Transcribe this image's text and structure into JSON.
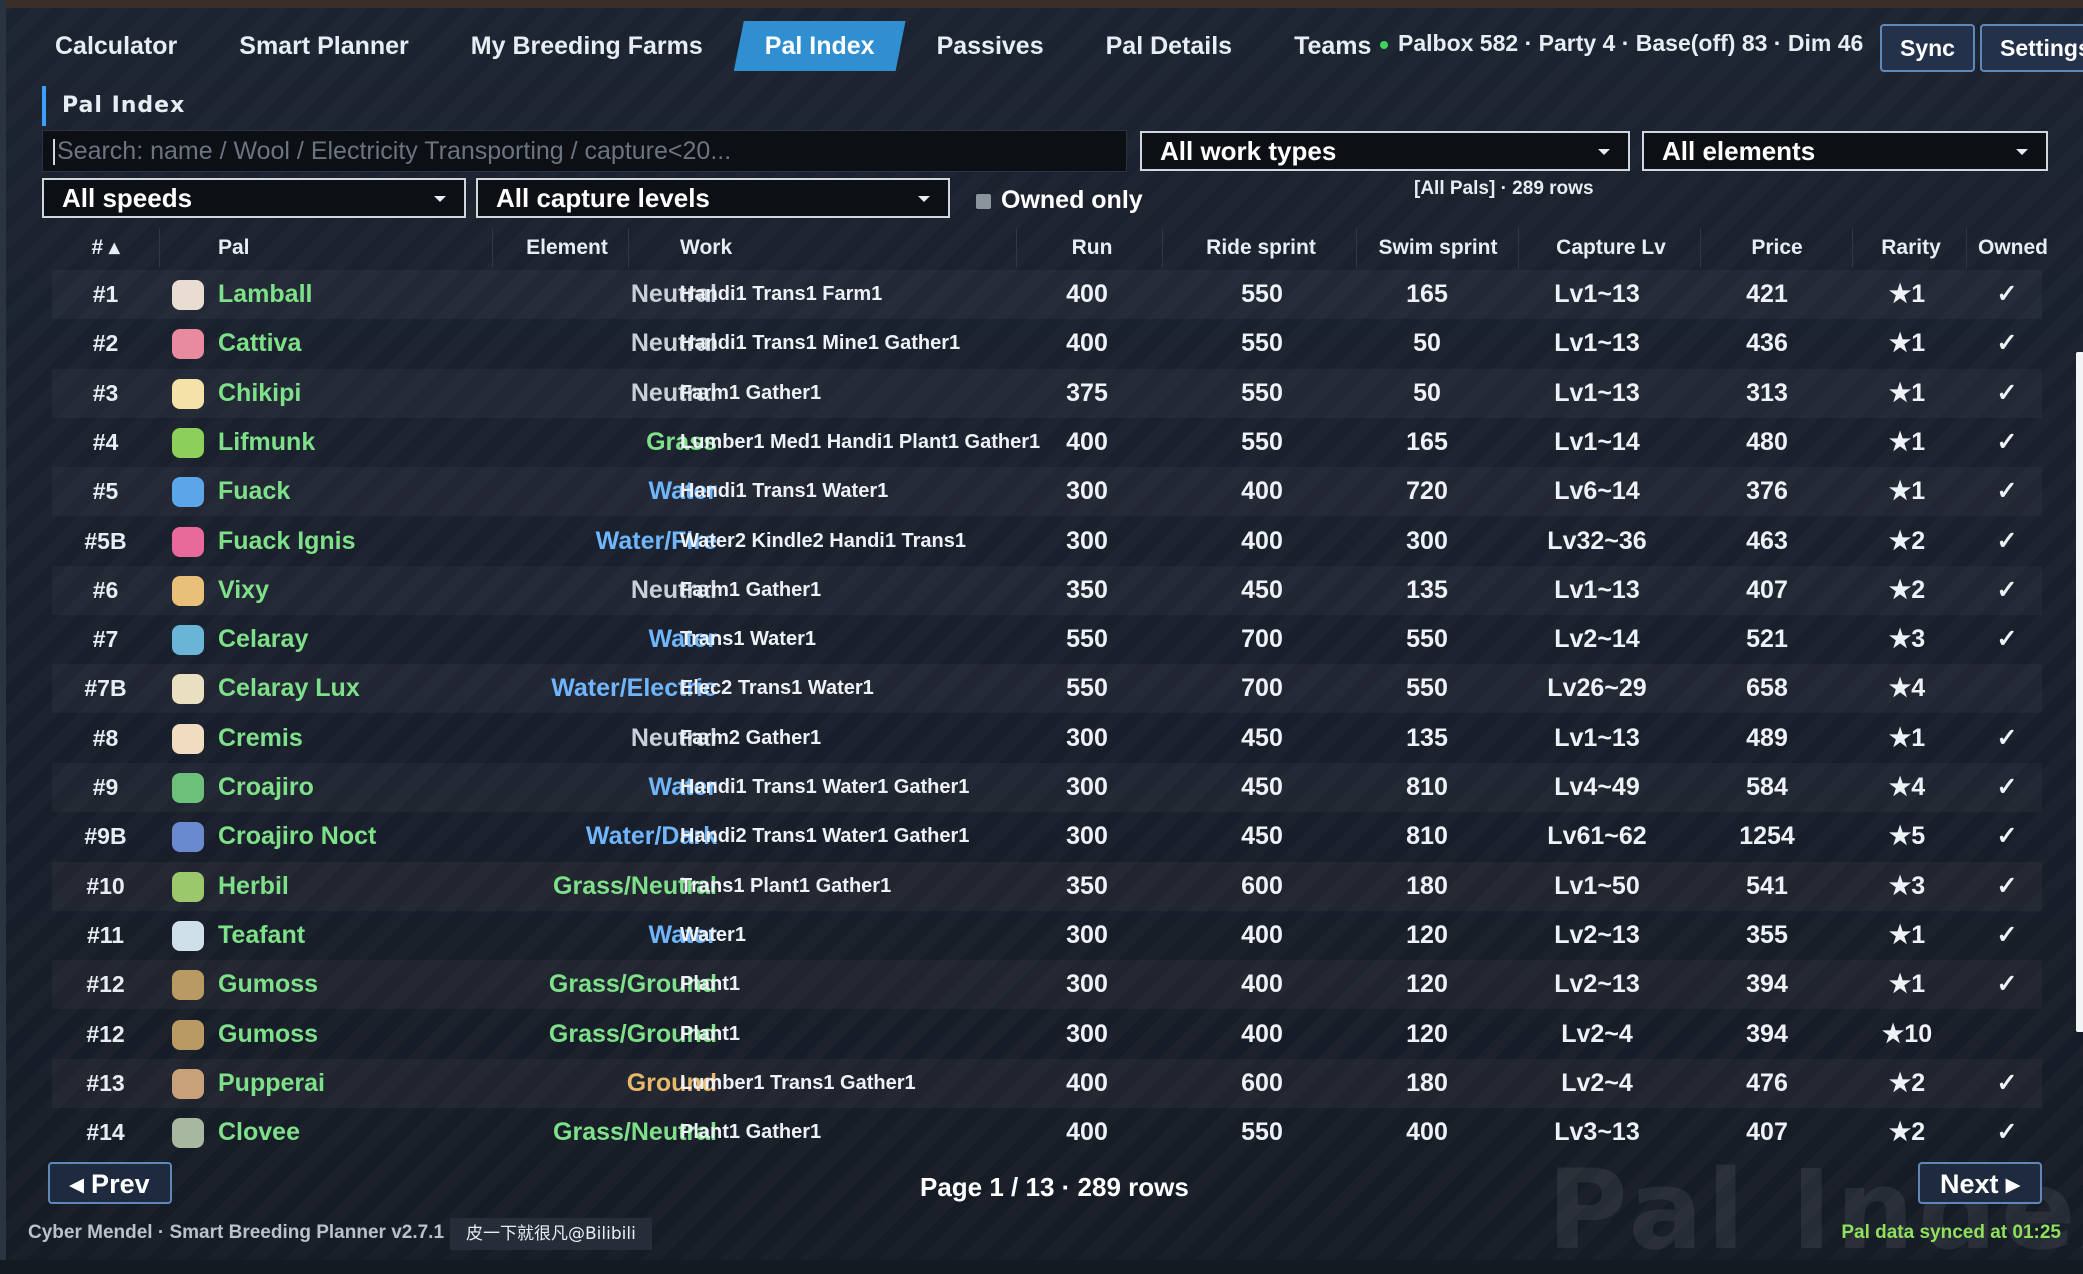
{
  "nav": {
    "tabs": [
      "Calculator",
      "Smart Planner",
      "My Breeding Farms",
      "Pal Index",
      "Passives",
      "Pal Details",
      "Teams"
    ],
    "active": "Pal Index"
  },
  "status": "Palbox 582 · Party 4 · Base(off) 83 · Dim 46",
  "buttons": {
    "sync": "Sync",
    "settings": "Settings"
  },
  "panel": {
    "title": "Pal Index",
    "search_placeholder": "Search: name / Wool / Electricity Transporting / capture<20...",
    "filters": {
      "work": "All work types",
      "element": "All elements",
      "speed": "All speeds",
      "capture": "All capture levels",
      "owned_only": "Owned only"
    },
    "rows_info": "[All Pals] · 289 rows"
  },
  "table": {
    "headers": {
      "num": "# ▴",
      "pal": "Pal",
      "element": "Element",
      "work": "Work",
      "run": "Run",
      "ride": "Ride sprint",
      "swim": "Swim sprint",
      "capture": "Capture Lv",
      "price": "Price",
      "rarity": "Rarity",
      "owned": "Owned"
    },
    "rows": [
      {
        "num": "#1",
        "name": "Lamball",
        "element": "Neutral",
        "work": "Handi1 Trans1 Farm1",
        "run": "400",
        "ride": "550",
        "swim": "165",
        "capture": "Lv1~13",
        "price": "421",
        "rarity": "★1",
        "owned": "✓",
        "icon": "lamball-icon",
        "icon_color": "#e9dcd0",
        "element_color": "#c9d0d8"
      },
      {
        "num": "#2",
        "name": "Cattiva",
        "element": "Neutral",
        "work": "Handi1 Trans1 Mine1 Gather1",
        "run": "400",
        "ride": "550",
        "swim": "50",
        "capture": "Lv1~13",
        "price": "436",
        "rarity": "★1",
        "owned": "✓",
        "icon": "cattiva-icon",
        "icon_color": "#e88aa0",
        "element_color": "#c9d0d8"
      },
      {
        "num": "#3",
        "name": "Chikipi",
        "element": "Neutral",
        "work": "Farm1 Gather1",
        "run": "375",
        "ride": "550",
        "swim": "50",
        "capture": "Lv1~13",
        "price": "313",
        "rarity": "★1",
        "owned": "✓",
        "icon": "chikipi-icon",
        "icon_color": "#f4e2a8",
        "element_color": "#c9d0d8"
      },
      {
        "num": "#4",
        "name": "Lifmunk",
        "element": "Grass",
        "work": "Lumber1 Med1 Handi1 Plant1 Gather1",
        "run": "400",
        "ride": "550",
        "swim": "165",
        "capture": "Lv1~14",
        "price": "480",
        "rarity": "★1",
        "owned": "✓",
        "icon": "lifmunk-icon",
        "icon_color": "#8ccf5a",
        "element_color": "#7fe08a"
      },
      {
        "num": "#5",
        "name": "Fuack",
        "element": "Water",
        "work": "Handi1 Trans1 Water1",
        "run": "300",
        "ride": "400",
        "swim": "720",
        "capture": "Lv6~14",
        "price": "376",
        "rarity": "★1",
        "owned": "✓",
        "icon": "fuack-icon",
        "icon_color": "#5aa6e8",
        "element_color": "#6fb6ff"
      },
      {
        "num": "#5B",
        "name": "Fuack Ignis",
        "element": "Water/Fire",
        "work": "Water2 Kindle2 Handi1 Trans1",
        "run": "300",
        "ride": "400",
        "swim": "300",
        "capture": "Lv32~36",
        "price": "463",
        "rarity": "★2",
        "owned": "✓",
        "icon": "fuack-ignis-icon",
        "icon_color": "#e86a9a",
        "element_color": "#6fb6ff"
      },
      {
        "num": "#6",
        "name": "Vixy",
        "element": "Neutral",
        "work": "Farm1 Gather1",
        "run": "350",
        "ride": "450",
        "swim": "135",
        "capture": "Lv1~13",
        "price": "407",
        "rarity": "★2",
        "owned": "✓",
        "icon": "vixy-icon",
        "icon_color": "#e8c07a",
        "element_color": "#c9d0d8"
      },
      {
        "num": "#7",
        "name": "Celaray",
        "element": "Water",
        "work": "Trans1 Water1",
        "run": "550",
        "ride": "700",
        "swim": "550",
        "capture": "Lv2~14",
        "price": "521",
        "rarity": "★3",
        "owned": "✓",
        "icon": "celaray-icon",
        "icon_color": "#6ab4d8",
        "element_color": "#6fb6ff"
      },
      {
        "num": "#7B",
        "name": "Celaray Lux",
        "element": "Water/Electric",
        "work": "Elec2 Trans1 Water1",
        "run": "550",
        "ride": "700",
        "swim": "550",
        "capture": "Lv26~29",
        "price": "658",
        "rarity": "★4",
        "owned": "",
        "icon": "celaray-lux-icon",
        "icon_color": "#e8e0c0",
        "element_color": "#6fb6ff"
      },
      {
        "num": "#8",
        "name": "Cremis",
        "element": "Neutral",
        "work": "Farm2 Gather1",
        "run": "300",
        "ride": "450",
        "swim": "135",
        "capture": "Lv1~13",
        "price": "489",
        "rarity": "★1",
        "owned": "✓",
        "icon": "cremis-icon",
        "icon_color": "#f0dcc0",
        "element_color": "#c9d0d8"
      },
      {
        "num": "#9",
        "name": "Croajiro",
        "element": "Water",
        "work": "Handi1 Trans1 Water1 Gather1",
        "run": "300",
        "ride": "450",
        "swim": "810",
        "capture": "Lv4~49",
        "price": "584",
        "rarity": "★4",
        "owned": "✓",
        "icon": "croajiro-icon",
        "icon_color": "#6cc07a",
        "element_color": "#6fb6ff"
      },
      {
        "num": "#9B",
        "name": "Croajiro Noct",
        "element": "Water/Dark",
        "work": "Handi2 Trans1 Water1 Gather1",
        "run": "300",
        "ride": "450",
        "swim": "810",
        "capture": "Lv61~62",
        "price": "1254",
        "rarity": "★5",
        "owned": "✓",
        "icon": "croajiro-noct-icon",
        "icon_color": "#6a8ad0",
        "element_color": "#6fb6ff"
      },
      {
        "num": "#10",
        "name": "Herbil",
        "element": "Grass/Neutral",
        "work": "Trans1 Plant1 Gather1",
        "run": "350",
        "ride": "600",
        "swim": "180",
        "capture": "Lv1~50",
        "price": "541",
        "rarity": "★3",
        "owned": "✓",
        "icon": "herbil-icon",
        "icon_color": "#9ac86a",
        "element_color": "#7fe08a"
      },
      {
        "num": "#11",
        "name": "Teafant",
        "element": "Water",
        "work": "Water1",
        "run": "300",
        "ride": "400",
        "swim": "120",
        "capture": "Lv2~13",
        "price": "355",
        "rarity": "★1",
        "owned": "✓",
        "icon": "teafant-icon",
        "icon_color": "#cfe0ea",
        "element_color": "#6fb6ff"
      },
      {
        "num": "#12",
        "name": "Gumoss",
        "element": "Grass/Ground",
        "work": "Plant1",
        "run": "300",
        "ride": "400",
        "swim": "120",
        "capture": "Lv2~13",
        "price": "394",
        "rarity": "★1",
        "owned": "✓",
        "icon": "gumoss-icon",
        "icon_color": "#b89a62",
        "element_color": "#7fe08a"
      },
      {
        "num": "#12",
        "name": "Gumoss",
        "element": "Grass/Ground",
        "work": "Plant1",
        "run": "300",
        "ride": "400",
        "swim": "120",
        "capture": "Lv2~4",
        "price": "394",
        "rarity": "★10",
        "owned": "",
        "icon": "gumoss-icon",
        "icon_color": "#b89a62",
        "element_color": "#7fe08a"
      },
      {
        "num": "#13",
        "name": "Pupperai",
        "element": "Ground",
        "work": "Lumber1 Trans1 Gather1",
        "run": "400",
        "ride": "600",
        "swim": "180",
        "capture": "Lv2~4",
        "price": "476",
        "rarity": "★2",
        "owned": "✓",
        "icon": "pupperai-icon",
        "icon_color": "#c8a07a",
        "element_color": "#e8b96a"
      },
      {
        "num": "#14",
        "name": "Clovee",
        "element": "Grass/Neutral",
        "work": "Plant1 Gather1",
        "run": "400",
        "ride": "550",
        "swim": "400",
        "capture": "Lv3~13",
        "price": "407",
        "rarity": "★2",
        "owned": "✓",
        "icon": "clovee-icon",
        "icon_color": "#a8b8a0",
        "element_color": "#7fe08a"
      }
    ]
  },
  "watermark": "Pal Index",
  "pagination": {
    "prev": "◂ Prev",
    "next": "Next ▸",
    "info": "Page 1 / 13 · 289 rows"
  },
  "footer": {
    "left": "Cyber Mendel · Smart Breeding Planner v2.7.1",
    "credit": "皮一下就很凡@Bilibili",
    "right": "Pal data synced at 01:25"
  }
}
